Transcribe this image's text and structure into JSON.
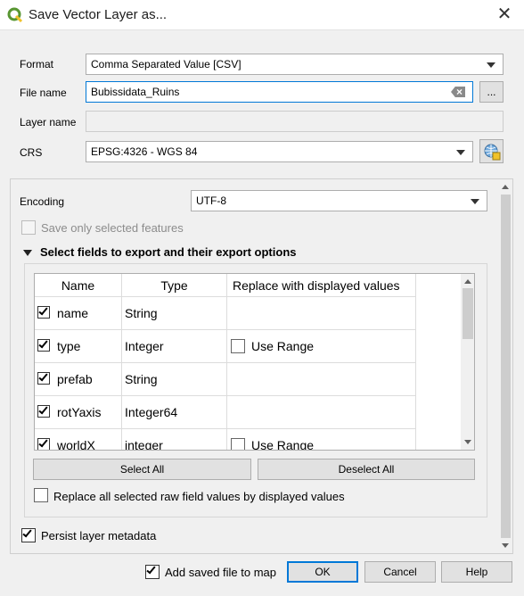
{
  "window": {
    "title": "Save Vector Layer as...",
    "icon": "qgis-logo-icon",
    "close": "close-icon"
  },
  "form": {
    "format_label": "Format",
    "format_value": "Comma Separated Value [CSV]",
    "filename_label": "File name",
    "filename_value": "Bubissidata_Ruins",
    "browse_label": "...",
    "layername_label": "Layer name",
    "layername_value": "",
    "crs_label": "CRS",
    "crs_value": "EPSG:4326 - WGS 84",
    "crs_icon": "crs-globe-icon"
  },
  "options": {
    "encoding_label": "Encoding",
    "encoding_value": "UTF-8",
    "save_selected_label": "Save only selected features",
    "fields_section_label": "Select fields to export and their export options",
    "persist_label": "Persist layer metadata"
  },
  "fields_table": {
    "headers": [
      "Name",
      "Type",
      "Replace with displayed values"
    ],
    "rows": [
      {
        "checked": true,
        "name": "name",
        "type": "String",
        "replace": ""
      },
      {
        "checked": true,
        "name": "type",
        "type": "Integer",
        "replace": "Use Range"
      },
      {
        "checked": true,
        "name": "prefab",
        "type": "String",
        "replace": ""
      },
      {
        "checked": true,
        "name": "rotYaxis",
        "type": "Integer64",
        "replace": ""
      },
      {
        "checked": true,
        "name": "worldX",
        "type": "integer",
        "replace": "Use Range"
      }
    ],
    "select_all": "Select All",
    "deselect_all": "Deselect All",
    "replace_all_label": "Replace all selected raw field values by displayed values"
  },
  "footer": {
    "add_to_map_label": "Add saved file to map",
    "ok": "OK",
    "cancel": "Cancel",
    "help": "Help"
  },
  "colors": {
    "accent": "#0078d7",
    "qgis_green": "#589632",
    "qgis_yellow": "#f0c22b"
  }
}
